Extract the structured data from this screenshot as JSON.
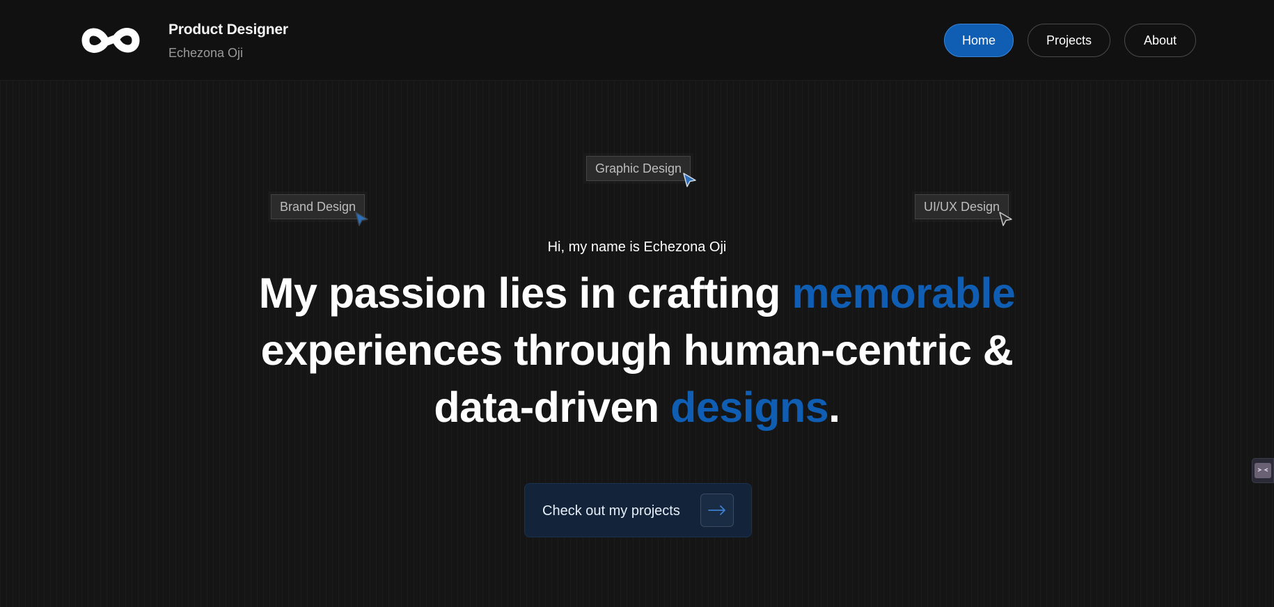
{
  "header": {
    "logo_icon": "eo-infinity-logo",
    "title": "Product Designer",
    "subtitle": "Echezona Oji",
    "nav": [
      {
        "label": "Home",
        "active": true
      },
      {
        "label": "Projects",
        "active": false
      },
      {
        "label": "About",
        "active": false
      }
    ]
  },
  "tags": {
    "graphic": "Graphic Design",
    "brand": "Brand Design",
    "uiux": "UI/UX Design"
  },
  "hero": {
    "greeting": "Hi, my name is Echezona Oji",
    "line1_prefix": "My passion lies in crafting ",
    "line1_accent": "memorable",
    "line2": "experiences through human-centric &",
    "line3_prefix": "data-driven ",
    "line3_accent": "designs",
    "line3_suffix": "."
  },
  "cta": {
    "label": "Check out my projects",
    "icon": "arrow-right-icon"
  },
  "colors": {
    "accent": "#0f5eb4",
    "background": "#151515",
    "header": "#111111"
  }
}
